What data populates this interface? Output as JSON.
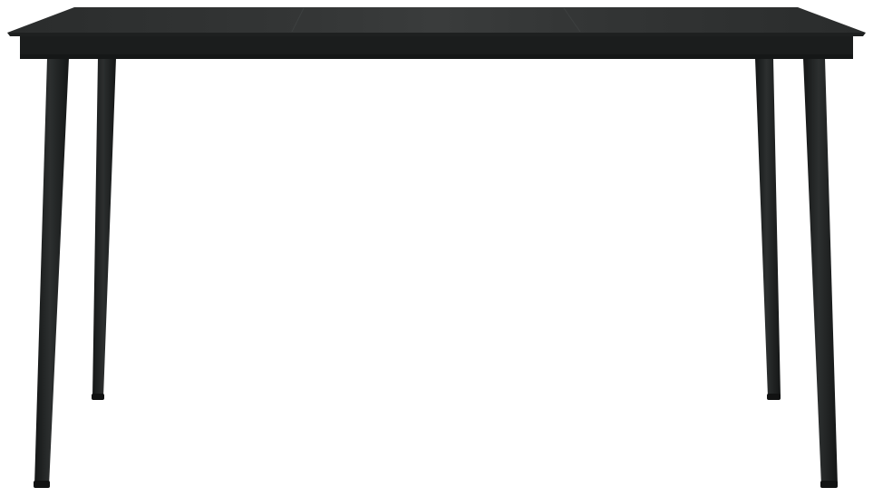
{
  "product": {
    "subject": "table",
    "colors": {
      "background": "#ffffff",
      "glass_top": "#2f3131",
      "glass_top_highlight": "#3a3c3c",
      "glass_edge": "#1e2020",
      "apron": "#1b1d1d",
      "leg": "#1a1c1c",
      "leg_highlight": "#2c2f2f",
      "foot_cap": "#111212"
    }
  }
}
